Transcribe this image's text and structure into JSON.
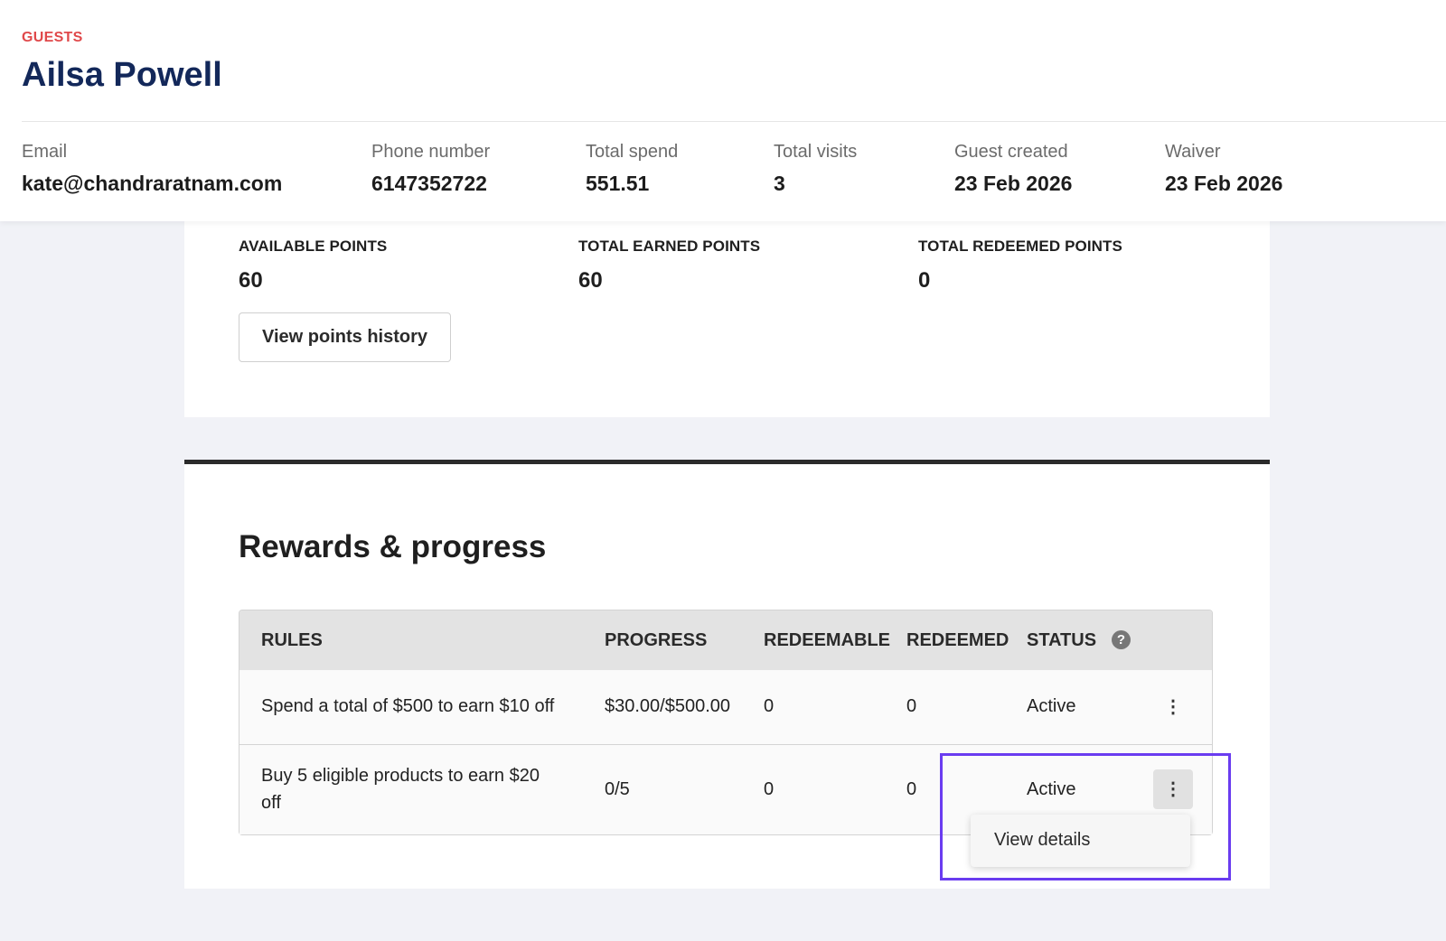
{
  "header": {
    "breadcrumb": "GUESTS",
    "guest_name": "Ailsa Powell",
    "fields": [
      {
        "label": "Email",
        "value": "kate@chandraratnam.com"
      },
      {
        "label": "Phone number",
        "value": "6147352722"
      },
      {
        "label": "Total spend",
        "value": "551.51"
      },
      {
        "label": "Total visits",
        "value": "3"
      },
      {
        "label": "Guest created",
        "value": "23 Feb 2026"
      },
      {
        "label": "Waiver",
        "value": "23 Feb 2026"
      }
    ]
  },
  "points": {
    "available_label": "AVAILABLE POINTS",
    "available_value": "60",
    "earned_label": "TOTAL EARNED POINTS",
    "earned_value": "60",
    "redeemed_label": "TOTAL REDEEMED POINTS",
    "redeemed_value": "0",
    "history_button": "View points history"
  },
  "rewards": {
    "title": "Rewards & progress",
    "columns": [
      "RULES",
      "PROGRESS",
      "REDEEMABLE",
      "REDEEMED",
      "STATUS"
    ],
    "help_icon": "question-circle-icon",
    "help_glyph": "?",
    "rows": [
      {
        "rule": "Spend a total of $500 to earn $10 off",
        "progress": "$30.00/$500.00",
        "redeemable": "0",
        "redeemed": "0",
        "status": "Active"
      },
      {
        "rule_line1": "Buy 5 eligible products to earn $20",
        "rule_line2": "off",
        "progress": "0/5",
        "redeemable": "0",
        "redeemed": "0",
        "status": "Active"
      }
    ],
    "kebab_icon": "more-vertical-icon",
    "kebab_glyph": "⋮",
    "menu": {
      "view_details": "View details"
    }
  },
  "colors": {
    "breadcrumb": "#e0484a",
    "name": "#13285a",
    "highlight": "#6a3cf0",
    "background": "#f1f2f7"
  }
}
